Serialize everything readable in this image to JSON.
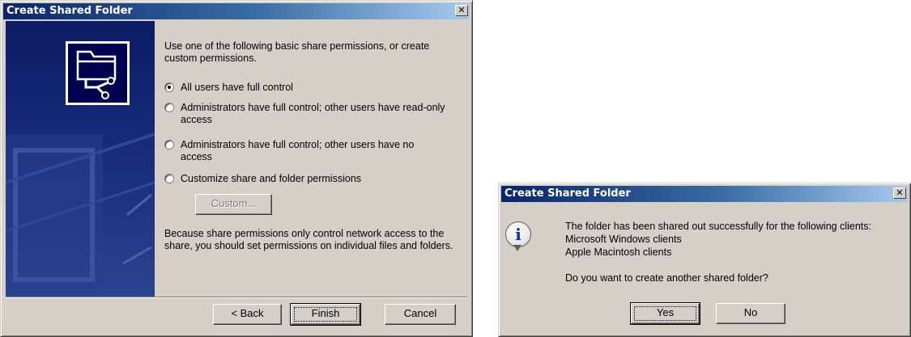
{
  "wizard": {
    "title": "Create Shared Folder",
    "close_glyph": "✕",
    "intro": "Use one of the following basic share permissions, or create custom permissions.",
    "options": [
      {
        "label": "All users have full control",
        "selected": true
      },
      {
        "label": "Administrators have full control; other users have read-only access",
        "selected": false
      },
      {
        "label": "Administrators have full control; other users have no access",
        "selected": false
      },
      {
        "label": "Customize share and folder permissions",
        "selected": false
      }
    ],
    "custom_button": "Custom...",
    "note": "Because share permissions only control network access to the share, you should set permissions on individual files and folders.",
    "back_button": "< Back",
    "finish_button": "Finish",
    "cancel_button": "Cancel",
    "sidebar_icon": "shared-folder-icon"
  },
  "message": {
    "title": "Create Shared Folder",
    "close_glyph": "✕",
    "icon": "info-icon",
    "icon_glyph": "i",
    "line1": "The folder has been shared out successfully for the following clients:",
    "line2": "Microsoft Windows clients",
    "line3": "Apple Macintosh clients",
    "question": "Do you want to create another shared folder?",
    "yes_button": "Yes",
    "no_button": "No"
  }
}
